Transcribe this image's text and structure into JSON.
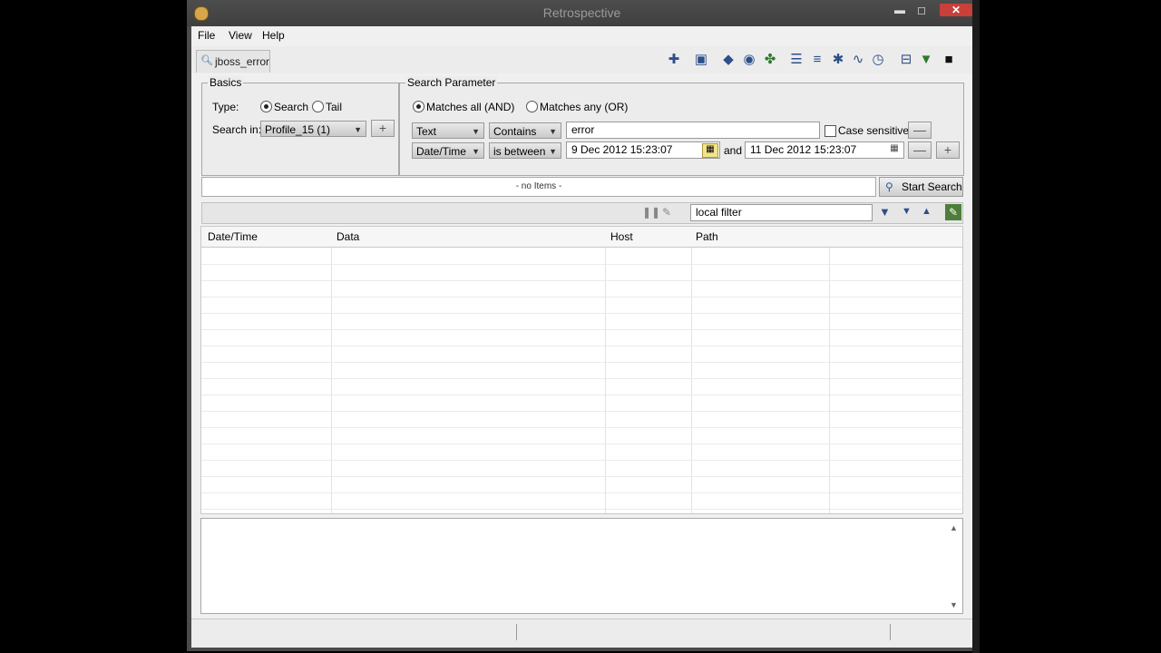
{
  "window": {
    "title": "Retrospective",
    "minimize": "▬",
    "maximize": "◻",
    "close": "✕"
  },
  "menu": {
    "file": "File",
    "view": "View",
    "help": "Help"
  },
  "tab": {
    "label": "jboss_error",
    "icon": "search-icon"
  },
  "toolbar_icons": [
    "add-icon",
    "save-icon",
    "diamond-icon",
    "eye-icon",
    "puzzle-icon",
    "list-icon",
    "list-lines-icon",
    "star-icon",
    "pulse-icon",
    "clock-icon",
    "tree-icon",
    "comment-icon",
    "terminal-icon"
  ],
  "basics": {
    "legend": "Basics",
    "type_label": "Type:",
    "radio_search": "Search",
    "radio_tail": "Tail",
    "search_in_label": "Search in:",
    "search_in_value": "Profile_15 (1)",
    "add_symbol": "+"
  },
  "params": {
    "legend": "Search Parameter",
    "match_all": "Matches all (AND)",
    "match_any": "Matches any (OR)",
    "row1": {
      "field": "Text",
      "op": "Contains",
      "value": "error",
      "case_sensitive": "Case sensitive",
      "remove": "—"
    },
    "row2": {
      "field": "Date/Time",
      "op": "is between",
      "from": "9 Dec 2012 15:23:07",
      "and": "and",
      "to": "11 Dec 2012 15:23:07",
      "remove": "—",
      "add": "+"
    }
  },
  "search_bar": {
    "status": "- no Items -",
    "start": "Start Search"
  },
  "filter": {
    "value": "local filter"
  },
  "columns": [
    "Date/Time",
    "Data",
    "Host",
    "Path"
  ],
  "accent": "#2d4f8a"
}
